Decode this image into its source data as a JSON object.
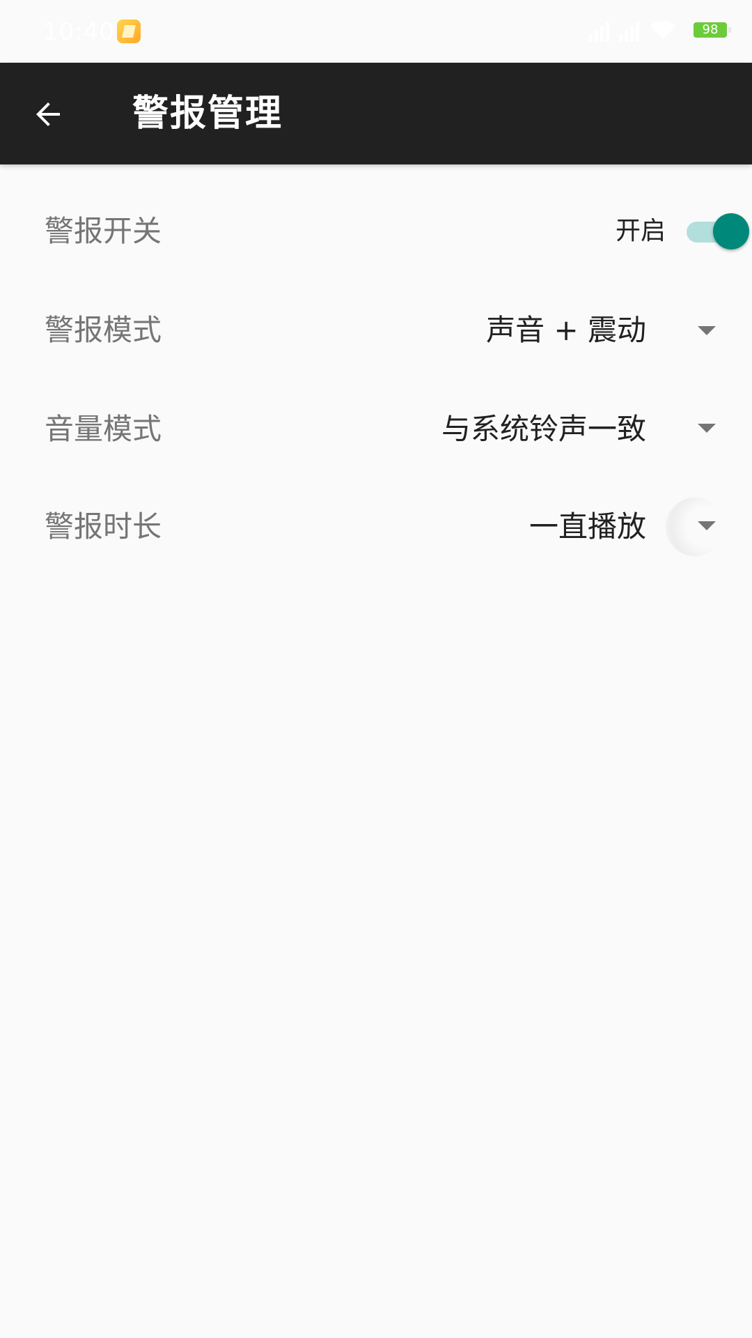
{
  "status_bar": {
    "time": "10:40",
    "battery": "98"
  },
  "app_bar": {
    "title": "警报管理"
  },
  "settings": {
    "alarm_switch": {
      "label": "警报开关",
      "state_text": "开启",
      "enabled": true
    },
    "alarm_mode": {
      "label": "警报模式",
      "value": "声音 + 震动"
    },
    "volume_mode": {
      "label": "音量模式",
      "value": "与系统铃声一致"
    },
    "alarm_duration": {
      "label": "警报时长",
      "value": "一直播放"
    }
  },
  "colors": {
    "app_bar": "#212121",
    "background": "#fafafa",
    "accent": "#00897b",
    "switch_track": "#b2dfdb",
    "label_text": "#757575",
    "value_text": "#212121",
    "battery": "#6ccb3a"
  },
  "icons": {
    "back": "arrow-left-icon",
    "dropdown": "triangle-down-icon",
    "app": "note-app-icon"
  }
}
